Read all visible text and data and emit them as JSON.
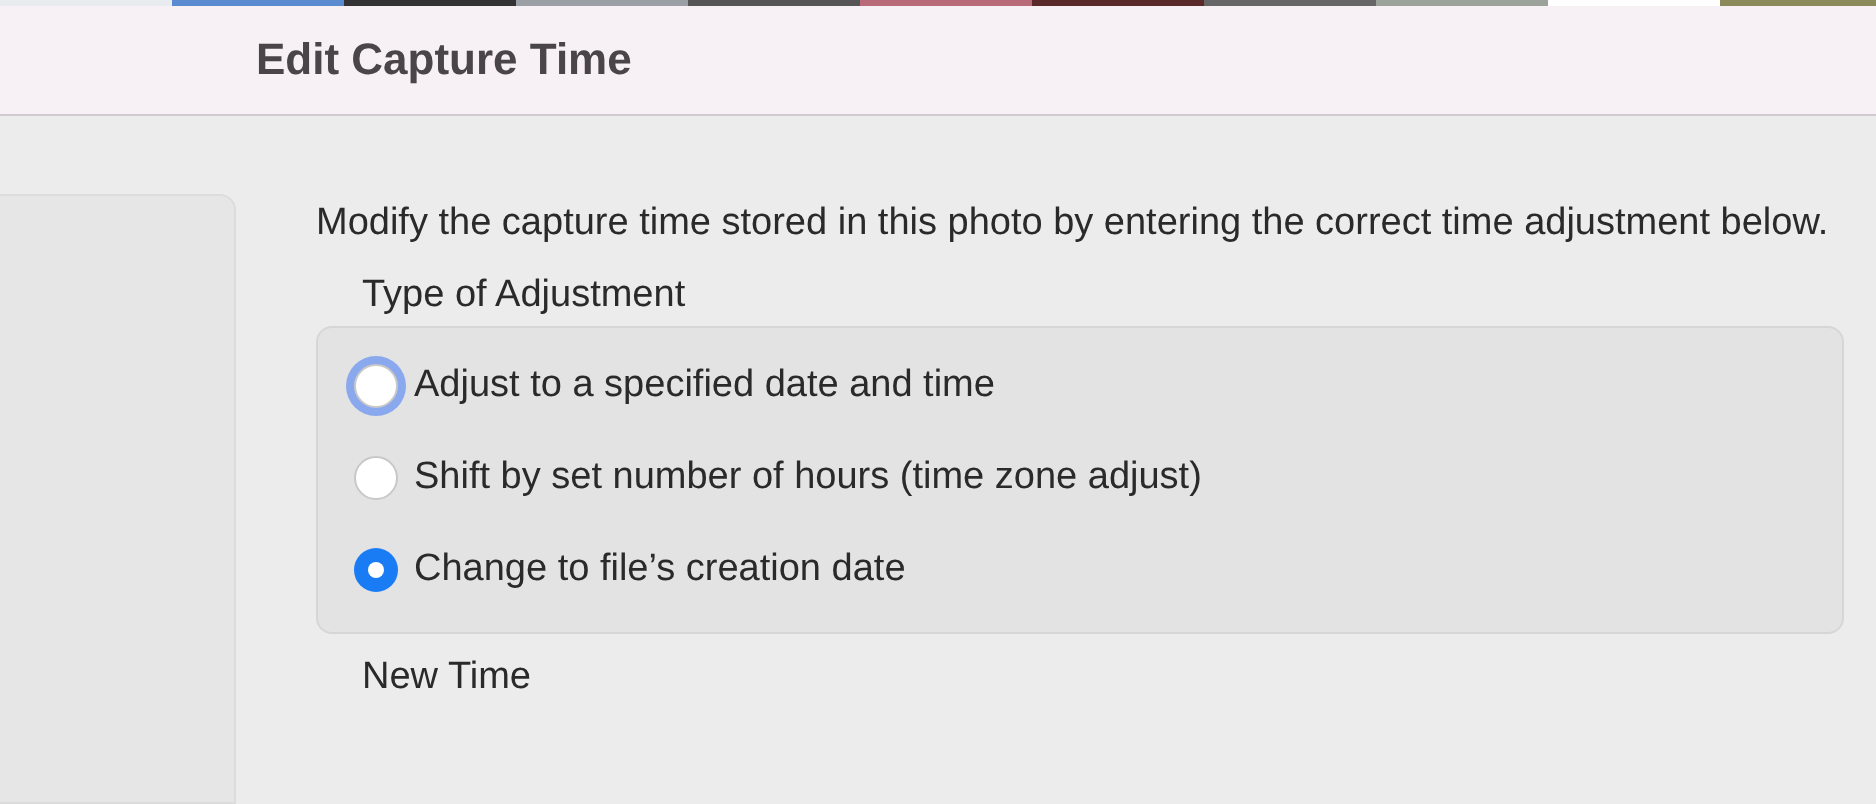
{
  "window": {
    "title": "Edit Capture Time"
  },
  "description": "Modify the capture time stored in this photo by entering the correct time adjustment below.",
  "adjustment": {
    "heading": "Type of Adjustment",
    "options": [
      {
        "label": "Adjust to a specified date and time",
        "selected": false,
        "focused": true
      },
      {
        "label": "Shift by set number of hours (time zone adjust)",
        "selected": false,
        "focused": false
      },
      {
        "label": "Change to file’s creation date",
        "selected": true,
        "focused": false
      }
    ]
  },
  "new_time": {
    "heading": "New Time"
  }
}
